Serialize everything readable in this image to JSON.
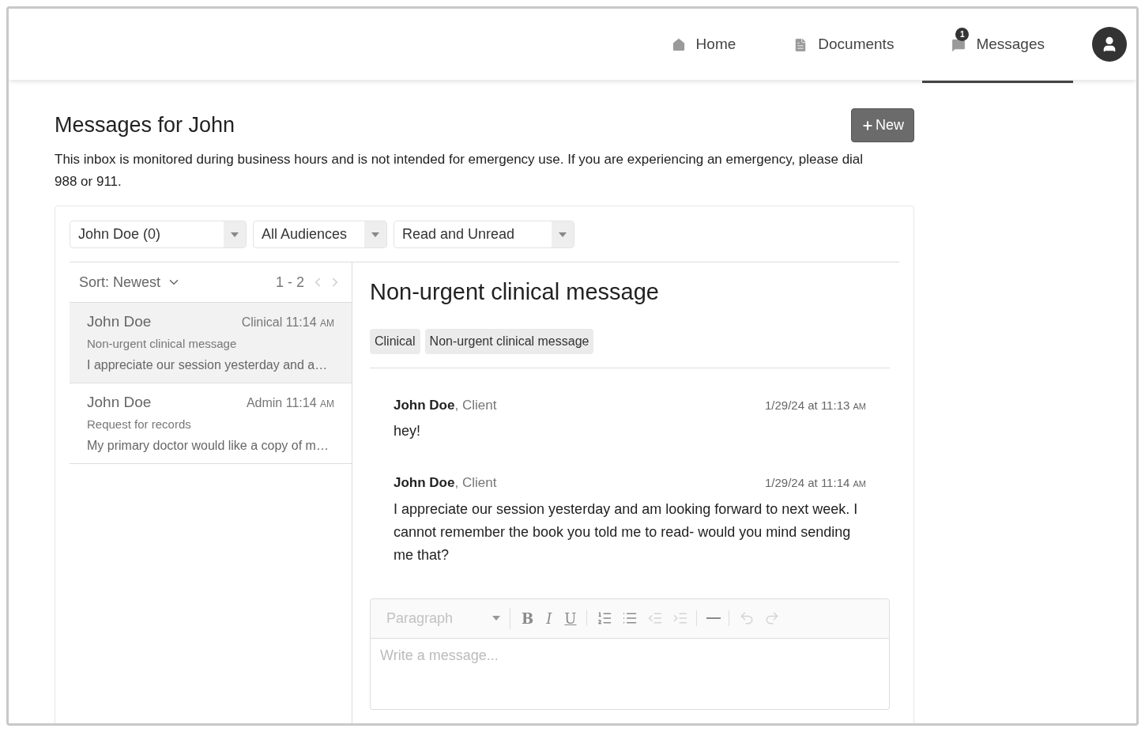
{
  "nav": {
    "items": [
      {
        "label": "Home",
        "kind": "home",
        "selected": false
      },
      {
        "label": "Documents",
        "kind": "document",
        "selected": false
      },
      {
        "label": "Messages",
        "kind": "chat",
        "selected": true,
        "badge": "1"
      }
    ]
  },
  "page": {
    "title": "Messages for John",
    "new_button": "New",
    "notice": "This inbox is monitored during business hours and is not intended for emergency use. If you are experiencing an emergency, please dial 988 or 911."
  },
  "filters": [
    {
      "value": "John Doe (0)"
    },
    {
      "value": "All Audiences"
    },
    {
      "value": "Read and Unread"
    }
  ],
  "list": {
    "sort": "Sort: Newest",
    "range": "1 - 2",
    "threads": [
      {
        "sender": "John Doe",
        "category": "Clinical",
        "time": "11:14",
        "meridiem": "AM",
        "subject": "Non-urgent clinical message",
        "preview": "I appreciate our session yesterday and a…",
        "selected": true
      },
      {
        "sender": "John Doe",
        "category": "Admin",
        "time": "11:14",
        "meridiem": "AM",
        "subject": "Request for records",
        "preview": "My primary doctor would like a copy of m…",
        "selected": false
      }
    ]
  },
  "thread": {
    "title": "Non-urgent clinical message",
    "tags": [
      "Clinical",
      "Non-urgent clinical message"
    ],
    "messages": [
      {
        "sender": "John Doe",
        "role": ", Client",
        "timestamp": "1/29/24 at 11:13",
        "meridiem": "AM",
        "body": "hey!"
      },
      {
        "sender": "John Doe",
        "role": ", Client",
        "timestamp": "1/29/24 at 11:14",
        "meridiem": "AM",
        "body": "I appreciate our session yesterday and am looking forward to next week. I cannot remember the book you told me to read- would you mind sending me that?"
      }
    ]
  },
  "editor": {
    "format": "Paragraph",
    "placeholder": "Write a message...",
    "groups": [
      [
        {
          "kind": "bold",
          "label": "B",
          "disabled": false
        },
        {
          "kind": "italic",
          "label": "I",
          "disabled": false
        },
        {
          "kind": "underline",
          "label": "U",
          "disabled": false
        }
      ],
      [
        {
          "kind": "ordered-list",
          "disabled": false
        },
        {
          "kind": "bullet-list",
          "disabled": false
        },
        {
          "kind": "outdent",
          "disabled": true
        },
        {
          "kind": "indent",
          "disabled": true
        }
      ],
      [
        {
          "kind": "rule",
          "disabled": false
        }
      ],
      [
        {
          "kind": "undo",
          "disabled": true
        },
        {
          "kind": "redo",
          "disabled": true
        }
      ]
    ]
  }
}
